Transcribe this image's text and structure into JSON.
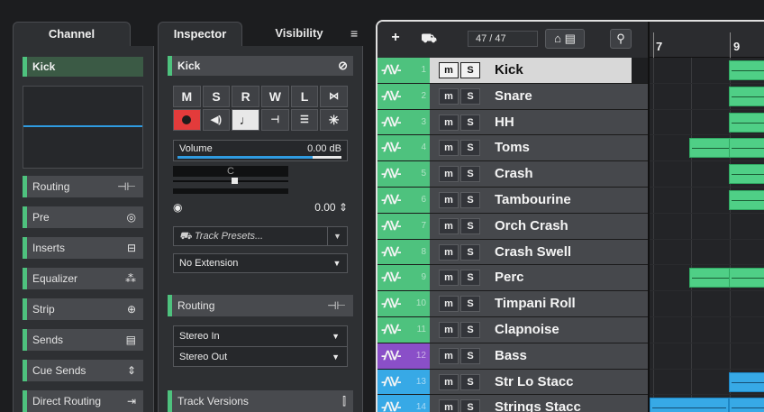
{
  "channel": {
    "tab_label": "Channel",
    "track_name": "Kick",
    "sections": [
      {
        "label": "Routing",
        "icon": "routing-icon",
        "glyph": "⊣⊢"
      },
      {
        "label": "Pre",
        "icon": "pre-icon",
        "glyph": "◎"
      },
      {
        "label": "Inserts",
        "icon": "inserts-icon",
        "glyph": "⊟"
      },
      {
        "label": "Equalizer",
        "icon": "equalizer-icon",
        "glyph": "⁂"
      },
      {
        "label": "Strip",
        "icon": "strip-icon",
        "glyph": "⊕"
      },
      {
        "label": "Sends",
        "icon": "sends-icon",
        "glyph": "▤"
      },
      {
        "label": "Cue Sends",
        "icon": "cue-sends-icon",
        "glyph": "⇕"
      },
      {
        "label": "Direct Routing",
        "icon": "direct-routing-icon",
        "glyph": "⇥"
      }
    ]
  },
  "inspector": {
    "tab_inspector": "Inspector",
    "tab_visibility": "Visibility",
    "menu_icon": "≡",
    "track_name": "Kick",
    "edit_icon": "⊘",
    "buttons_row1": [
      "M",
      "S",
      "R",
      "W",
      "L",
      "⋈"
    ],
    "buttons_row2": [
      "●",
      "◀)",
      "♩",
      "⊣",
      "☰",
      "✳"
    ],
    "volume_label": "Volume",
    "volume_value": "0.00 dB",
    "pan_label": "C",
    "tune_value": "0.00",
    "track_presets_placeholder": "Track Presets...",
    "extension_value": "No Extension",
    "routing_label": "Routing",
    "input_routing": "Stereo In",
    "output_routing": "Stereo Out",
    "track_versions_label": "Track Versions"
  },
  "tracklist": {
    "track_count": "47 / 47",
    "tracks": [
      {
        "num": "1",
        "name": "Kick",
        "color": "#4ec27e",
        "selected": true
      },
      {
        "num": "2",
        "name": "Snare",
        "color": "#4ec27e"
      },
      {
        "num": "3",
        "name": "HH",
        "color": "#4ec27e"
      },
      {
        "num": "4",
        "name": "Toms",
        "color": "#4ec27e"
      },
      {
        "num": "5",
        "name": "Crash",
        "color": "#4ec27e"
      },
      {
        "num": "6",
        "name": "Tambourine",
        "color": "#4ec27e"
      },
      {
        "num": "7",
        "name": "Orch Crash",
        "color": "#4ec27e"
      },
      {
        "num": "8",
        "name": "Crash Swell",
        "color": "#4ec27e"
      },
      {
        "num": "9",
        "name": "Perc",
        "color": "#4ec27e"
      },
      {
        "num": "10",
        "name": "Timpani Roll",
        "color": "#4ec27e"
      },
      {
        "num": "11",
        "name": "Clapnoise",
        "color": "#4ec27e"
      },
      {
        "num": "12",
        "name": "Bass",
        "color": "#8a4fc8"
      },
      {
        "num": "13",
        "name": "Str Lo Stacc",
        "color": "#37a9e6"
      },
      {
        "num": "14",
        "name": "Strings Stacc",
        "color": "#37a9e6"
      }
    ]
  },
  "ruler": {
    "bars": [
      "7",
      "9"
    ]
  },
  "colors": {
    "audio_green": "#4ec27e",
    "bass_purple": "#8a4fc8",
    "strings_blue": "#37a9e6",
    "meter_blue": "#2f9be0",
    "record_red": "#e33b3b"
  }
}
